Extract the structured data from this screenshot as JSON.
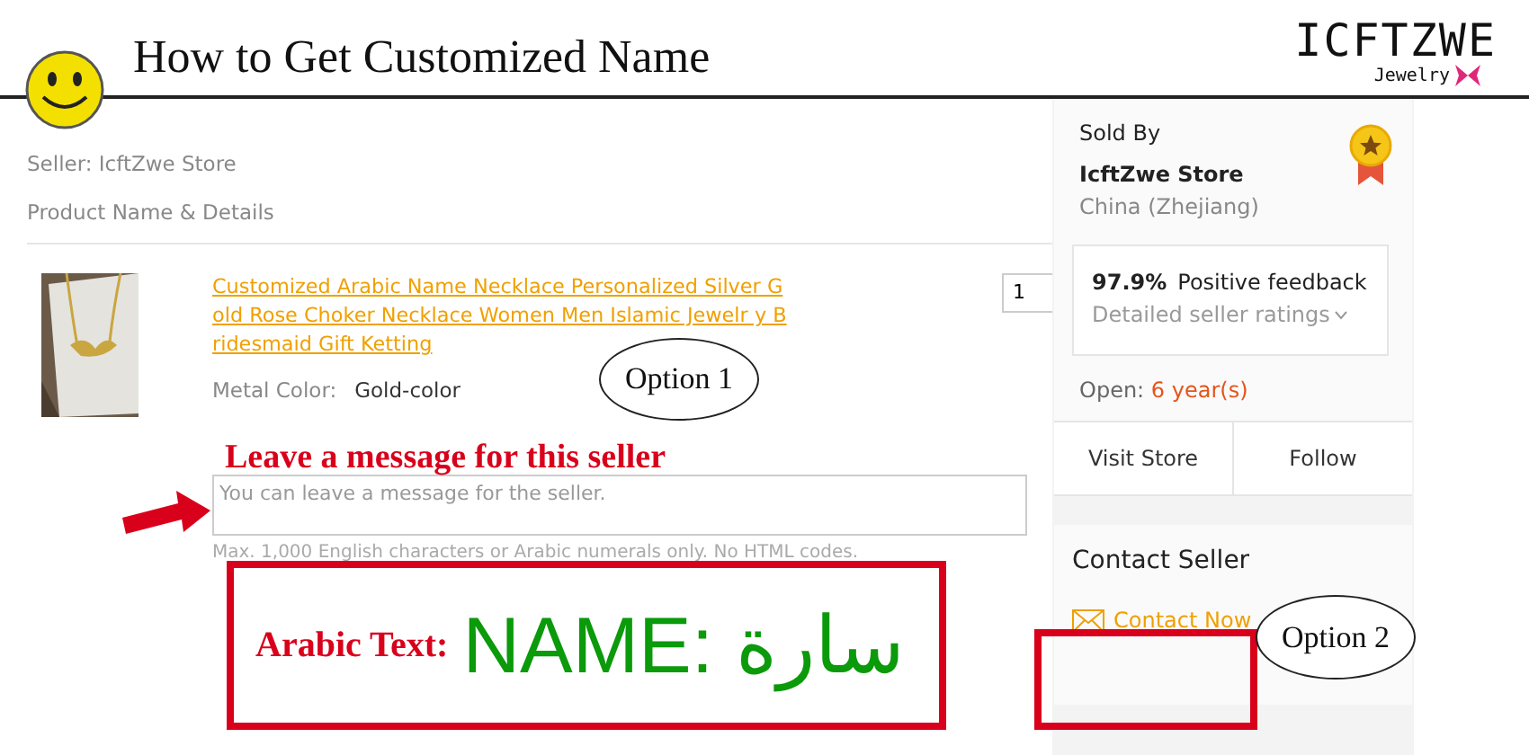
{
  "header": {
    "title": "How to Get Customized Name",
    "logo": {
      "name": "ICFTZWE",
      "tagline": "Jewelry"
    }
  },
  "order": {
    "seller": "Seller: IcftZwe Store",
    "section_label": "Product Name & Details",
    "product": {
      "kind": "picture",
      "title": "Customized Arabic Name Necklace Personalized Silver Gold Rose Choker Necklace Women Men Islamic Jewelr y Bridesmaid Gift Ketting",
      "quantity": "1",
      "attribute_label": "Metal Color:",
      "attribute_value": "Gold-color"
    },
    "message": {
      "placeholder": "You can leave a message for the seller.",
      "hint": "Max. 1,000 English characters or Arabic numerals only. No HTML codes."
    }
  },
  "seller_card": {
    "label": "Sold By",
    "store": "IcftZwe Store",
    "location": "China (Zhejiang)",
    "feedback_percent": "97.9%",
    "feedback_label": "Positive feedback",
    "ratings_link": "Detailed seller ratings",
    "open_label": "Open:",
    "open_value": "6 year(s)",
    "buttons": [
      "Visit Store",
      "Follow"
    ]
  },
  "contact": {
    "title": "Contact Seller",
    "link": "Contact Now"
  },
  "annotations": {
    "message_callout": "Leave a message for this seller",
    "example_label": "Arabic Text:",
    "example_value": "NAME: سارة",
    "options": [
      "Option 1",
      "Option 2"
    ]
  }
}
